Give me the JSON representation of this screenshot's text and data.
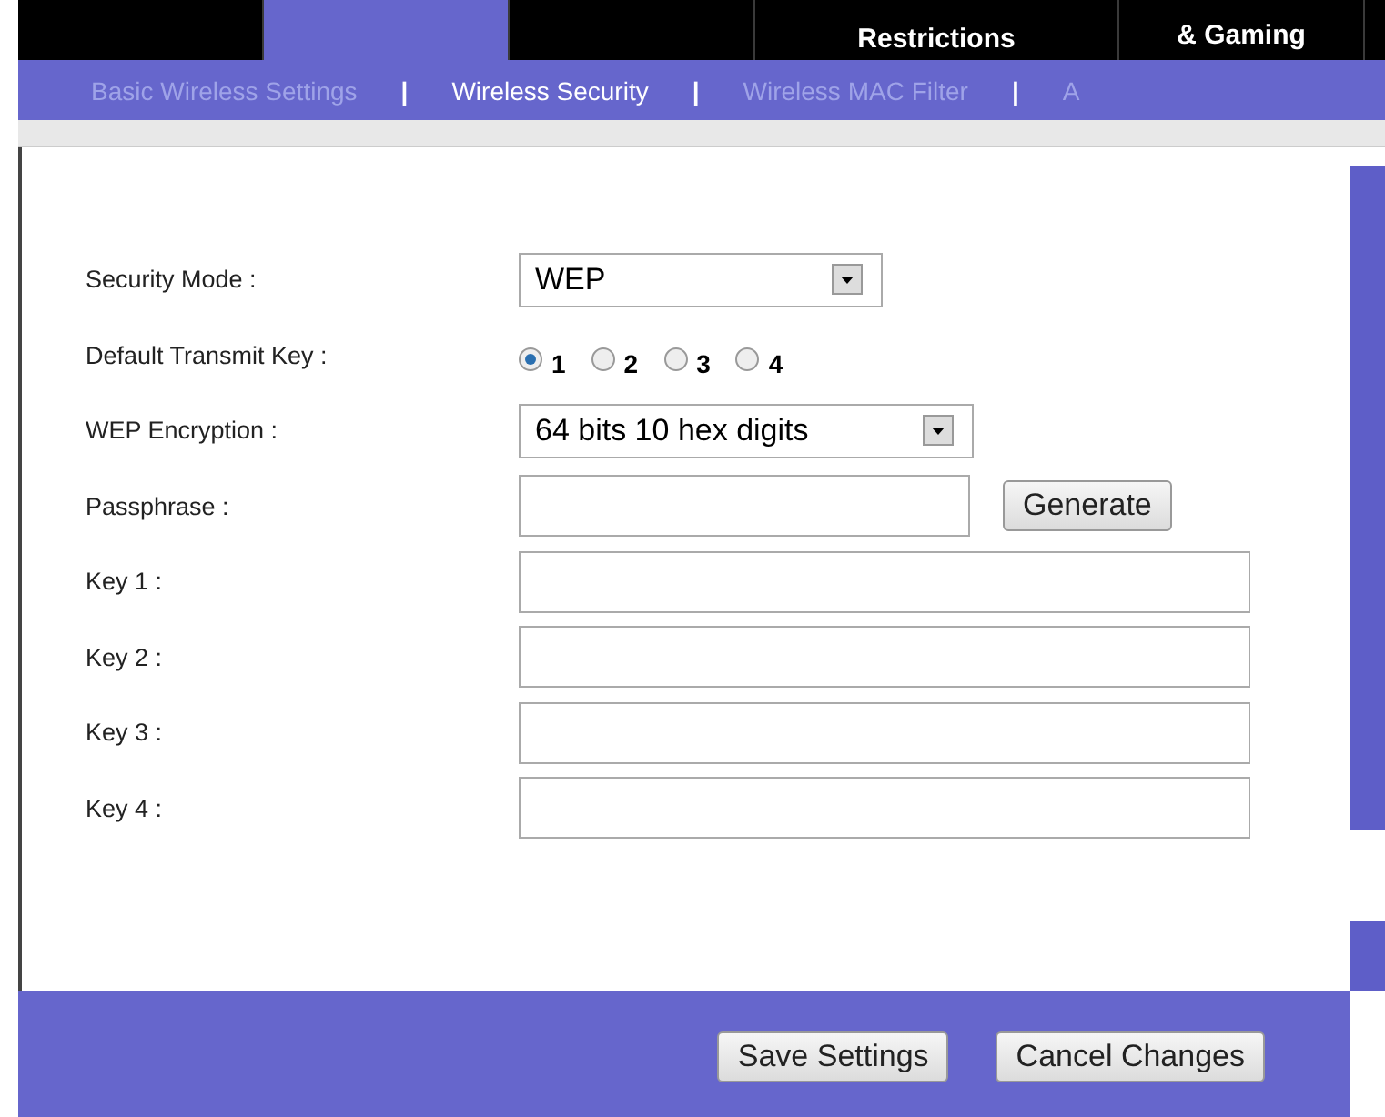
{
  "tabs": [
    {
      "selected": false
    },
    {
      "selected": true
    },
    {
      "selected": false
    },
    {
      "label": "Restrictions",
      "selected": false
    },
    {
      "label": "& Gaming",
      "selected": false
    }
  ],
  "subnav": [
    {
      "label": "Basic Wireless Settings",
      "selected": false
    },
    {
      "label": "Wireless Security",
      "selected": true
    },
    {
      "label": "Wireless MAC Filter",
      "selected": false
    },
    {
      "label": "A",
      "selected": false
    }
  ],
  "subnav_separator": "|",
  "form": {
    "security_mode": {
      "label": "Security Mode  :",
      "value": "WEP"
    },
    "transmit_key": {
      "label": "Default Transmit  Key  :",
      "options": [
        {
          "label": "1",
          "selected": true
        },
        {
          "label": "2",
          "selected": false
        },
        {
          "label": "3",
          "selected": false
        },
        {
          "label": "4",
          "selected": false
        }
      ]
    },
    "encryption": {
      "label": "WEP Encryption  :",
      "value": "64 bits 10 hex digits"
    },
    "passphrase": {
      "label": "Passphrase  :",
      "button": "Generate"
    },
    "keys": [
      {
        "label": "Key 1  :"
      },
      {
        "label": "Key 2  :"
      },
      {
        "label": "Key 3  :"
      },
      {
        "label": "Key 4  :"
      }
    ]
  },
  "buttons": [
    "Save Settings",
    "Cancel Changes"
  ]
}
